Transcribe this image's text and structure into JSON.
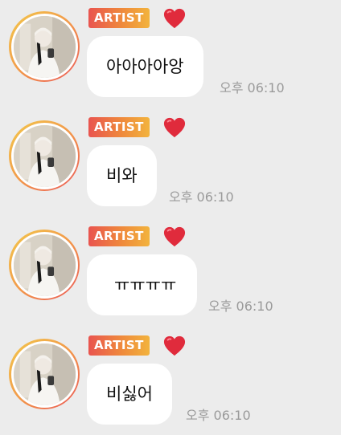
{
  "messages": [
    {
      "badge": "ARTIST",
      "text": "아아아아앙",
      "time": "오후 06:10"
    },
    {
      "badge": "ARTIST",
      "text": "비와",
      "time": "오후 06:10"
    },
    {
      "badge": "ARTIST",
      "text": "ㅠㅠㅠㅠ",
      "time": "오후 06:10"
    },
    {
      "badge": "ARTIST",
      "text": "비싫어",
      "time": "오후 06:10"
    }
  ],
  "colors": {
    "background": "#ececec",
    "bubble": "#ffffff",
    "badge_gradient": [
      "#e9544f",
      "#f2b33d"
    ],
    "heart": "#e02b3c",
    "time": "#9a9a9a"
  },
  "icons": {
    "reaction": "heart-icon",
    "avatar": "avatar"
  }
}
